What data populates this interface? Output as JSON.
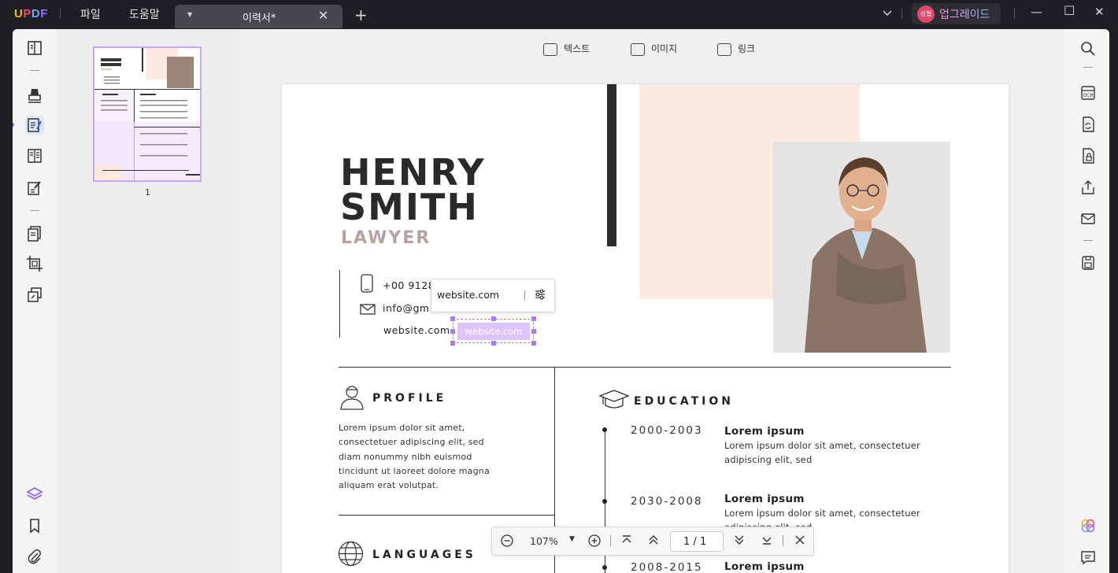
{
  "app": {
    "logo": {
      "l1": "U",
      "l2": "P",
      "l3": "D",
      "l4": "F"
    },
    "menu": {
      "file": "파일",
      "help": "도움말"
    },
    "tab": {
      "title": "이력서*",
      "close": "✕",
      "dropdown": "▼",
      "new": "+"
    },
    "upgrade": {
      "avatar_text": "성철",
      "label": "업그레이드"
    },
    "window": {
      "minimize": "—",
      "maximize": "☐",
      "close": "✕",
      "expand": "⌄"
    }
  },
  "edit_toolbar": {
    "text": "텍스트",
    "image": "이미지",
    "link": "링크"
  },
  "thumbnail": {
    "page_number": "1"
  },
  "resume": {
    "first_name": "HENRY",
    "last_name": "SMITH",
    "role": "LAWYER",
    "phone": "+00 91283",
    "email": "info@gm",
    "website": "website.com",
    "profile": {
      "title": "PROFILE",
      "lines": [
        "Lorem ipsum dolor sit amet,",
        "consectetuer adipiscing elit, sed",
        "diam nonummy nibh euismod",
        "tincidunt ut laoreet dolore magna",
        "aliquam erat volutpat."
      ]
    },
    "languages": {
      "title": "LANGUAGES"
    },
    "education": {
      "title": "EDUCATION",
      "items": [
        {
          "year": "2000-2003",
          "heading": "Lorem ipsum",
          "line1": "Lorem ipsum dolor sit amet, consectetuer",
          "line2": "adipiscing elit, sed"
        },
        {
          "year": "2030-2008",
          "heading": "Lorem ipsum",
          "line1": "Lorem ipsum dolor sit amet, consectetuer",
          "line2": "adipiscing elit, sed"
        },
        {
          "year": "2008-2015",
          "heading": "Lorem ipsum",
          "line1": "",
          "line2": ""
        }
      ]
    }
  },
  "link_popup": {
    "value": "website.com",
    "highlight": "website.com"
  },
  "zoom": {
    "value": "107%",
    "page_current": "1",
    "page_sep": "/",
    "page_total": "1"
  },
  "colors": {
    "accent": "#a97cf5",
    "pink_block": "#fde9e0",
    "role_text": "#b8a2a0"
  }
}
